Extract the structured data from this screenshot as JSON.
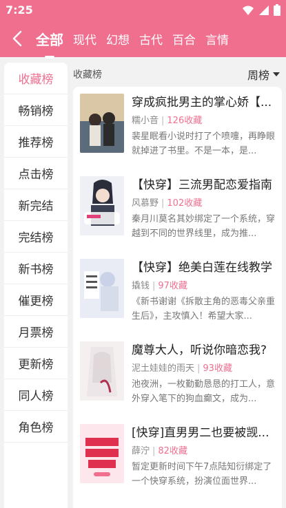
{
  "status": {
    "time": "7:25"
  },
  "tabs": [
    "全部",
    "现代",
    "幻想",
    "古代",
    "百合",
    "言情"
  ],
  "sidebar": [
    "收藏榜",
    "畅销榜",
    "推荐榜",
    "点击榜",
    "新完结",
    "完结榜",
    "新书榜",
    "催更榜",
    "月票榜",
    "更新榜",
    "同人榜",
    "角色榜"
  ],
  "list": {
    "name": "收藏榜",
    "sort": "周榜"
  },
  "books": [
    {
      "title": "穿成疯批男主的掌心娇【...",
      "author": "糯小音",
      "favorites": "126收藏",
      "desc": "裴星眠看小说时打了个喷嚏，再睁眼就掉进了书里。不是一本，是..."
    },
    {
      "title": "【快穿】三流男配恋爱指南",
      "author": "风慕野",
      "favorites": "102收藏",
      "desc": "秦月川莫名其妙绑定了一个系统，穿越到不同的世界线里，成为推..."
    },
    {
      "title": "【快穿】绝美白莲在线教学",
      "author": "撬钱",
      "favorites": "97收藏",
      "desc": "《新书谢谢《拆散主角的恶毒父亲重生后》，主攻慎入！希望大家..."
    },
    {
      "title": "魔尊大人，听说你暗恋我?",
      "author": "泥土娃娃的雨天",
      "favorites": "93收藏",
      "desc": "池夜洲，一枚勤勤恳恳的打工人，意外穿入笔下的狗血癫文，成为..."
    },
    {
      "title": "[快穿]直男男二也要被觊...",
      "author": "薛泞",
      "favorites": "82收藏",
      "desc": "暂定更新时间下午7点陆知衍绑定了一个快穿系统，扮演位面世界..."
    }
  ]
}
